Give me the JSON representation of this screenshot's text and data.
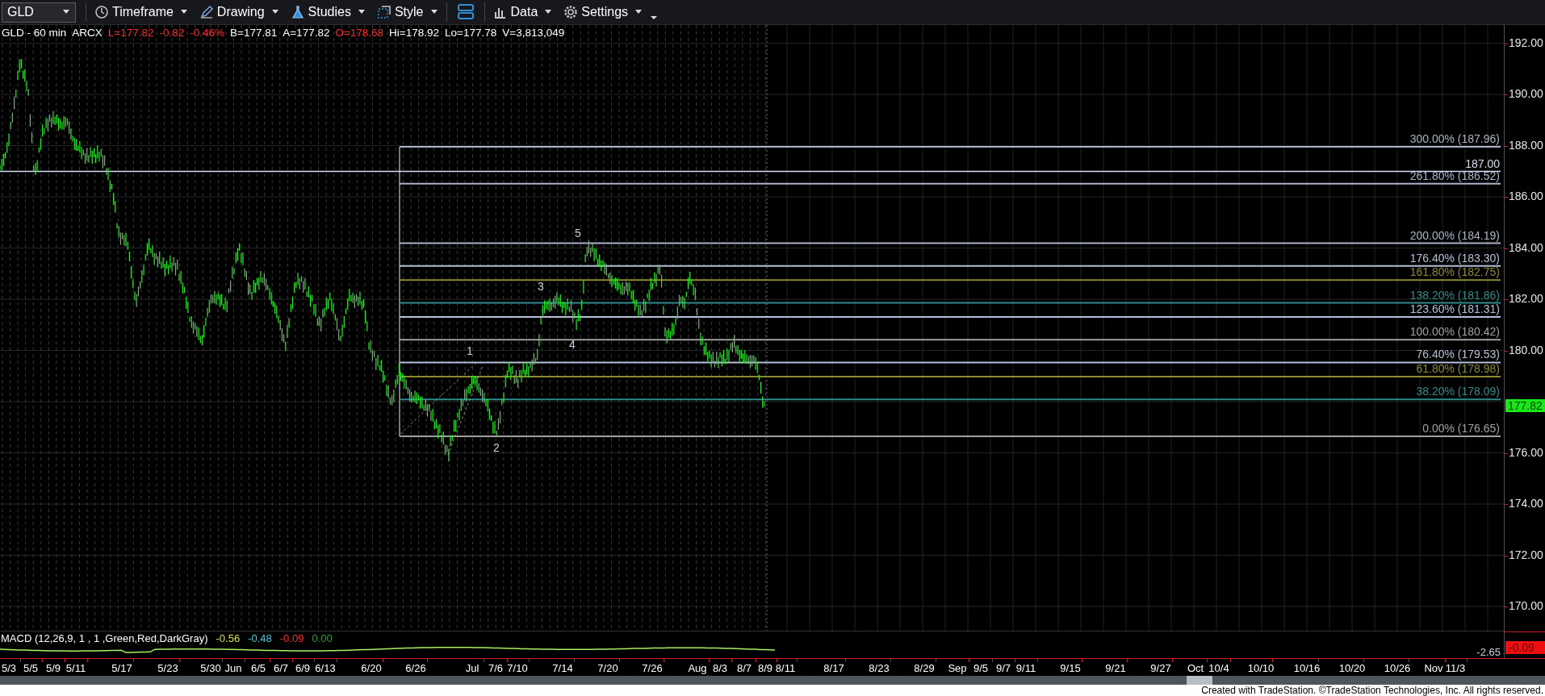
{
  "toolbar": {
    "symbol": "GLD",
    "menus": [
      {
        "label": "Timeframe"
      },
      {
        "label": "Drawing"
      },
      {
        "label": "Studies"
      },
      {
        "label": "Style"
      },
      {
        "label": "Data"
      },
      {
        "label": "Settings"
      }
    ]
  },
  "quote": [
    {
      "text": "GLD - 60 min",
      "color": "#ffffff"
    },
    {
      "text": "ARCX",
      "color": "#ffffff"
    },
    {
      "text": "L=177.82",
      "color": "#ff2a2a"
    },
    {
      "text": "-0.82",
      "color": "#ff2a2a"
    },
    {
      "text": "-0.46%",
      "color": "#ff2a2a"
    },
    {
      "text": "B=177.81",
      "color": "#ffffff"
    },
    {
      "text": "A=177.82",
      "color": "#ffffff"
    },
    {
      "text": "O=178.68",
      "color": "#ff2a2a"
    },
    {
      "text": "Hi=178.92",
      "color": "#ffffff"
    },
    {
      "text": "Lo=177.78",
      "color": "#ffffff"
    },
    {
      "text": "V=3,813,049",
      "color": "#ffffff"
    }
  ],
  "price_axis": {
    "labels": [
      "192.00",
      "190.00",
      "188.00",
      "186.00",
      "184.00",
      "182.00",
      "180.00",
      "176.00",
      "174.00",
      "172.00",
      "170.00"
    ],
    "last_price": "177.82"
  },
  "fib_levels": [
    {
      "label": "300.00% (187.96)",
      "color": "#aab2c8"
    },
    {
      "label": "261.80% (186.52)",
      "color": "#aab2c8"
    },
    {
      "label": "200.00% (184.19)",
      "color": "#aab2c8"
    },
    {
      "label": "176.40% (183.30)",
      "color": "#b4bfd8"
    },
    {
      "label": "161.80% (182.75)",
      "color": "#8c8a2c"
    },
    {
      "label": "138.20% (181.86)",
      "color": "#2e8a8a"
    },
    {
      "label": "123.60% (181.31)",
      "color": "#b4bfd8"
    },
    {
      "label": "100.00% (180.42)",
      "color": "#a0a0a0"
    },
    {
      "label": "76.40% (179.53)",
      "color": "#b4bfd8"
    },
    {
      "label": "61.80% (178.98)",
      "color": "#8c8a2c"
    },
    {
      "label": "38.20% (178.09)",
      "color": "#2e8a8a"
    },
    {
      "label": "0.00% (176.65)",
      "color": "#a0a0a0"
    }
  ],
  "horizontal_line": {
    "label": "187.00"
  },
  "wave_labels": [
    "1",
    "2",
    "3",
    "4",
    "5"
  ],
  "macd": {
    "labels": [
      {
        "text": "MACD (12,26,9, 1 , 1 ,Green,Red,DarkGray)",
        "color": "#ffffff"
      },
      {
        "text": "-0.56",
        "color": "#e0e040"
      },
      {
        "text": "-0.48",
        "color": "#40d0e8"
      },
      {
        "text": "-0.09",
        "color": "#ff2a2a"
      },
      {
        "text": "0.00",
        "color": "#30a030"
      }
    ],
    "axis_value": "-2.65",
    "last_value": "-0.09"
  },
  "date_axis": [
    "5/3",
    "5/5",
    "5/9",
    "5/11",
    "5/17",
    "5/23",
    "5/30",
    "Jun",
    "6/5",
    "6/7",
    "6/9",
    "6/13",
    "6/20",
    "6/26",
    "Jul",
    "7/6",
    "7/10",
    "7/14",
    "7/20",
    "7/26",
    "Aug",
    "8/3",
    "8/7",
    "8/9",
    "8/11",
    "8/17",
    "8/23",
    "8/29",
    "Sep",
    "9/5",
    "9/7",
    "9/11",
    "9/15",
    "9/21",
    "9/27",
    "Oct",
    "10/4",
    "10/10",
    "10/16",
    "10/20",
    "10/26",
    "Nov",
    "11/3"
  ],
  "footer": "Created with TradeStation. ©TradeStation Technologies, Inc. All rights reserved."
}
